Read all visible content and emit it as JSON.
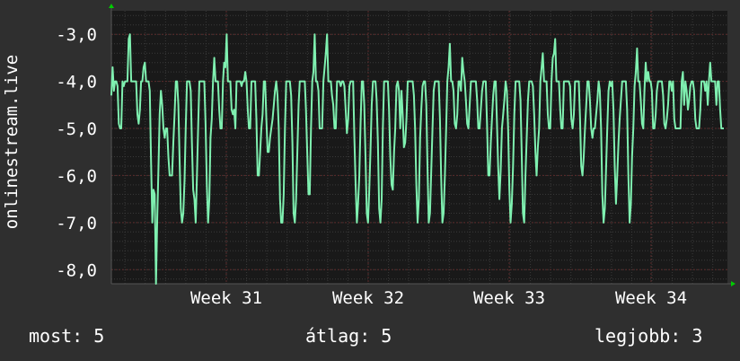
{
  "chart_data": {
    "type": "line",
    "ylabel": "onlinestream.live",
    "yticks": [
      -3,
      -4,
      -5,
      -6,
      -7,
      -8
    ],
    "ytick_labels": [
      "-3,0",
      "-4,0",
      "-5,0",
      "-6,0",
      "-7,0",
      "-8,0"
    ],
    "ylim": [
      -8.3,
      -2.5
    ],
    "xticks": [
      "Week 31",
      "Week 32",
      "Week 33",
      "Week 34"
    ],
    "grid": true,
    "colors": {
      "background": "#2f2f2f",
      "plot_background": "#191919",
      "grid_major": "#5a2a2a",
      "grid_minor": "#3a3a3a",
      "line": "#7ff0b0",
      "axis_arrow": "#00cc00"
    },
    "series": [
      {
        "values": [
          -4.3,
          -3.7,
          -4.2,
          -4.0,
          -4.0,
          -4.1,
          -4.9,
          -5.0,
          -5.0,
          -4.0,
          -4.1,
          -4.0,
          -4.0,
          -4.0,
          -3.1,
          -3.0,
          -4.0,
          -4.0,
          -4.0,
          -4.0,
          -4.0,
          -4.7,
          -4.9,
          -4.6,
          -4.0,
          -4.0,
          -3.7,
          -3.6,
          -4.0,
          -4.0,
          -4.0,
          -4.2,
          -5.7,
          -7.0,
          -6.3,
          -6.4,
          -8.3,
          -6.9,
          -5.8,
          -4.7,
          -4.2,
          -4.5,
          -5.0,
          -5.2,
          -5.0,
          -5.0,
          -5.6,
          -6.0,
          -6.0,
          -6.0,
          -5.3,
          -4.7,
          -4.0,
          -4.0,
          -4.5,
          -5.6,
          -6.7,
          -7.0,
          -6.8,
          -6.1,
          -5.0,
          -4.0,
          -4.0,
          -4.0,
          -4.2,
          -5.3,
          -6.3,
          -6.5,
          -7.0,
          -6.0,
          -5.0,
          -4.0,
          -4.0,
          -4.0,
          -4.0,
          -4.0,
          -4.9,
          -6.2,
          -7.0,
          -6.5,
          -5.2,
          -4.8,
          -4.0,
          -3.5,
          -4.0,
          -4.0,
          -4.0,
          -4.6,
          -5.0,
          -5.0,
          -4.0,
          -3.6,
          -3.7,
          -3.0,
          -4.0,
          -4.0,
          -4.0,
          -4.6,
          -4.7,
          -4.6,
          -5.0,
          -4.0,
          -4.0,
          -4.0,
          -4.0,
          -4.1,
          -4.0,
          -4.0,
          -3.8,
          -4.0,
          -4.6,
          -5.0,
          -5.0,
          -4.0,
          -4.0,
          -4.0,
          -4.0,
          -4.8,
          -6.0,
          -6.0,
          -5.5,
          -5.0,
          -4.7,
          -4.0,
          -4.0,
          -4.8,
          -5.5,
          -5.5,
          -5.2,
          -5.0,
          -4.8,
          -4.5,
          -4.2,
          -4.0,
          -4.3,
          -5.0,
          -6.5,
          -7.0,
          -7.0,
          -6.4,
          -5.0,
          -4.0,
          -4.0,
          -4.0,
          -4.0,
          -4.3,
          -5.3,
          -6.8,
          -7.0,
          -6.5,
          -5.5,
          -4.5,
          -4.0,
          -4.0,
          -4.0,
          -4.0,
          -4.0,
          -4.6,
          -5.5,
          -6.4,
          -6.4,
          -5.0,
          -4.0,
          -3.8,
          -3.0,
          -4.0,
          -4.0,
          -4.2,
          -5.0,
          -5.0,
          -5.0,
          -4.0,
          -3.7,
          -3.4,
          -3.0,
          -4.0,
          -4.0,
          -4.0,
          -4.3,
          -4.5,
          -5.0,
          -5.0,
          -4.0,
          -4.0,
          -4.0,
          -4.1,
          -4.0,
          -4.0,
          -4.1,
          -4.6,
          -5.1,
          -4.8,
          -4.1,
          -4.0,
          -4.0,
          -4.0,
          -5.2,
          -6.2,
          -7.0,
          -6.6,
          -6.0,
          -4.9,
          -4.0,
          -4.0,
          -4.5,
          -5.6,
          -6.8,
          -7.0,
          -6.3,
          -5.5,
          -4.5,
          -4.0,
          -4.0,
          -4.0,
          -4.4,
          -5.3,
          -6.7,
          -7.0,
          -6.5,
          -5.0,
          -4.0,
          -4.0,
          -4.0,
          -4.0,
          -4.6,
          -5.6,
          -6.2,
          -6.3,
          -5.5,
          -5.0,
          -4.1,
          -4.0,
          -4.2,
          -5.0,
          -4.2,
          -4.7,
          -5.4,
          -5.3,
          -4.8,
          -4.0,
          -4.0,
          -4.0,
          -4.0,
          -4.0,
          -4.3,
          -5.0,
          -6.2,
          -7.0,
          -6.5,
          -5.2,
          -4.6,
          -4.1,
          -4.0,
          -4.0,
          -4.5,
          -5.8,
          -7.0,
          -6.8,
          -5.9,
          -5.0,
          -4.2,
          -4.0,
          -4.0,
          -4.0,
          -4.0,
          -4.8,
          -6.0,
          -7.0,
          -6.8,
          -6.0,
          -5.0,
          -4.0,
          -3.7,
          -3.2,
          -4.0,
          -4.0,
          -4.2,
          -4.9,
          -5.0,
          -4.7,
          -4.0,
          -4.0,
          -4.2,
          -3.5,
          -3.8,
          -4.0,
          -4.4,
          -4.9,
          -5.0,
          -4.5,
          -4.0,
          -4.0,
          -4.0,
          -4.0,
          -4.0,
          -4.4,
          -5.0,
          -5.0,
          -4.6,
          -4.2,
          -4.0,
          -4.0,
          -4.0,
          -4.9,
          -6.0,
          -6.0,
          -5.3,
          -4.8,
          -4.3,
          -4.0,
          -4.0,
          -4.9,
          -5.8,
          -6.5,
          -5.9,
          -5.0,
          -4.7,
          -4.4,
          -4.0,
          -4.2,
          -5.0,
          -6.3,
          -7.0,
          -6.6,
          -5.8,
          -4.7,
          -4.0,
          -4.0,
          -4.0,
          -4.0,
          -4.4,
          -5.6,
          -6.8,
          -7.0,
          -6.0,
          -5.2,
          -4.4,
          -4.0,
          -4.0,
          -4.0,
          -4.1,
          -4.7,
          -5.5,
          -6.0,
          -5.4,
          -5.0,
          -4.0,
          -3.7,
          -3.4,
          -4.0,
          -4.0,
          -4.0,
          -4.7,
          -5.0,
          -5.0,
          -4.0,
          -3.5,
          -3.4,
          -3.1,
          -4.0,
          -4.0,
          -4.0,
          -4.6,
          -5.0,
          -5.0,
          -4.0,
          -4.0,
          -4.0,
          -4.0,
          -4.0,
          -4.1,
          -4.8,
          -5.0,
          -4.7,
          -4.0,
          -4.0,
          -4.0,
          -4.0,
          -4.8,
          -5.8,
          -6.0,
          -5.6,
          -5.0,
          -4.5,
          -4.0,
          -4.0,
          -4.4,
          -5.0,
          -5.2,
          -5.0,
          -5.0,
          -4.7,
          -4.4,
          -4.0,
          -4.2,
          -5.0,
          -6.4,
          -7.0,
          -6.7,
          -5.9,
          -5.0,
          -4.2,
          -4.0,
          -4.1,
          -4.0,
          -4.6,
          -5.8,
          -6.6,
          -6.0,
          -5.3,
          -4.8,
          -4.4,
          -4.0,
          -4.0,
          -4.0,
          -4.0,
          -4.6,
          -6.0,
          -7.0,
          -6.6,
          -5.6,
          -5.0,
          -4.1,
          -3.8,
          -3.3,
          -4.0,
          -4.0,
          -4.4,
          -4.9,
          -5.0,
          -4.2,
          -3.6,
          -4.0,
          -3.8,
          -4.0,
          -4.0,
          -4.2,
          -5.0,
          -5.0,
          -4.7,
          -4.2,
          -4.0,
          -4.0,
          -4.0,
          -4.0,
          -4.3,
          -4.9,
          -5.0,
          -4.8,
          -4.5,
          -4.0,
          -4.0,
          -4.2,
          -4.0,
          -4.8,
          -5.0,
          -5.0,
          -5.0,
          -5.0,
          -5.0,
          -4.0,
          -3.8,
          -4.5,
          -4.0,
          -4.2,
          -4.6,
          -4.4,
          -4.1,
          -4.0,
          -4.0,
          -4.2,
          -4.8,
          -5.0,
          -5.0,
          -5.0,
          -4.6,
          -4.0,
          -4.0,
          -4.0,
          -4.2,
          -4.0,
          -4.5,
          -4.0,
          -3.6,
          -4.0,
          -4.0,
          -4.0,
          -4.0,
          -4.5,
          -4.0,
          -4.0,
          -4.6,
          -5.0,
          -5.0,
          -5.0
        ]
      }
    ]
  },
  "legend": {
    "now_label": "most:",
    "now_value": "5",
    "avg_label": "átlag:",
    "avg_value": "5",
    "best_label": "legjobb:",
    "best_value": "3"
  }
}
